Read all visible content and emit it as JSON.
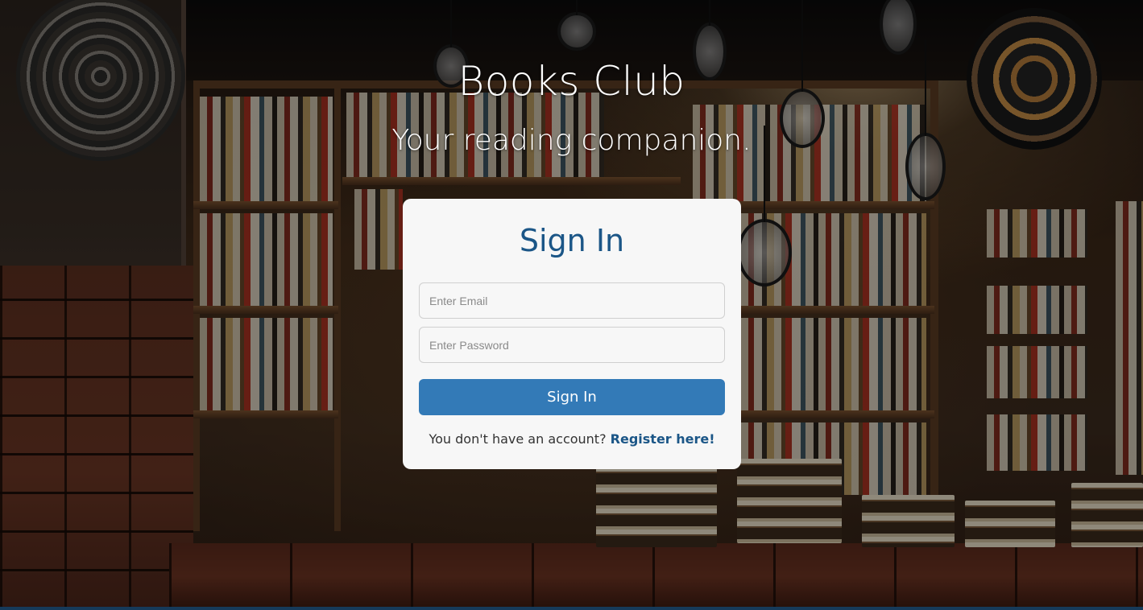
{
  "header": {
    "title": "Books Club",
    "tagline": "Your reading companion."
  },
  "signin": {
    "heading": "Sign In",
    "email_placeholder": "Enter Email",
    "password_placeholder": "Enter Password",
    "submit_label": "Sign In",
    "register_prompt": "You don't have an account?",
    "register_link": "Register here!"
  },
  "colors": {
    "accent": "#337ab7",
    "heading": "#1b5687",
    "card_background": "#f7f7f7"
  }
}
